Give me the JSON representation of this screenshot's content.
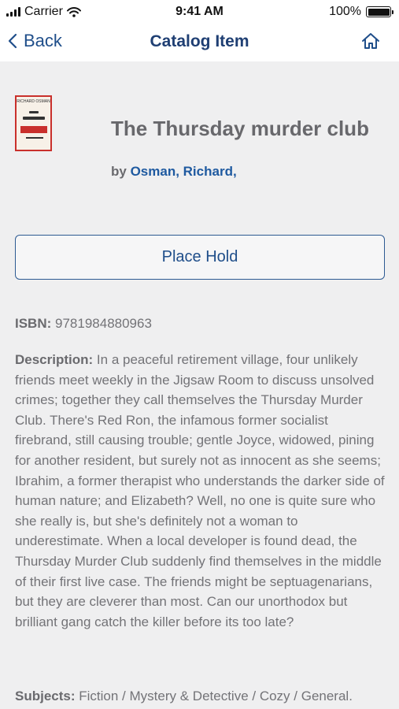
{
  "status": {
    "carrier": "Carrier",
    "time": "9:41 AM",
    "battery": "100%"
  },
  "nav": {
    "back_label": "Back",
    "title": "Catalog Item"
  },
  "item": {
    "title": "The Thursday murder club",
    "by_prefix": "by",
    "author": "Osman, Richard,",
    "cover_author": "RICHARD OSMAN",
    "hold_button": "Place Hold",
    "isbn_label": "ISBN:",
    "isbn": "9781984880963",
    "description_label": "Description:",
    "description": "In a peaceful retirement village, four unlikely friends meet weekly in the Jigsaw Room to discuss unsolved crimes; together they call themselves the Thursday Murder Club. There's Red Ron, the infamous former socialist firebrand, still causing trouble; gentle Joyce, widowed, pining for another resident, but surely not as innocent as she seems; Ibrahim, a former therapist who understands the darker side of human nature; and Elizabeth? Well, no one is quite sure who she really is, but she's definitely not a woman to underestimate. When a local developer is found dead, the Thursday Murder Club suddenly find themselves in the middle of their first live case. The friends might be septuagenarians, but they are cleverer than most. Can our unorthodox but brilliant gang catch the killer before its too late?",
    "subjects_label": "Subjects:",
    "subjects": "Fiction / Mystery & Detective / Cozy / General."
  },
  "colors": {
    "accent": "#1f4e8a",
    "title": "#1f3f73",
    "background": "#efeff0",
    "cover_red": "#c9302c"
  },
  "icons": {
    "back": "chevron-left-icon",
    "home": "home-icon",
    "wifi": "wifi-icon",
    "signal": "signal-icon",
    "battery": "battery-icon"
  }
}
